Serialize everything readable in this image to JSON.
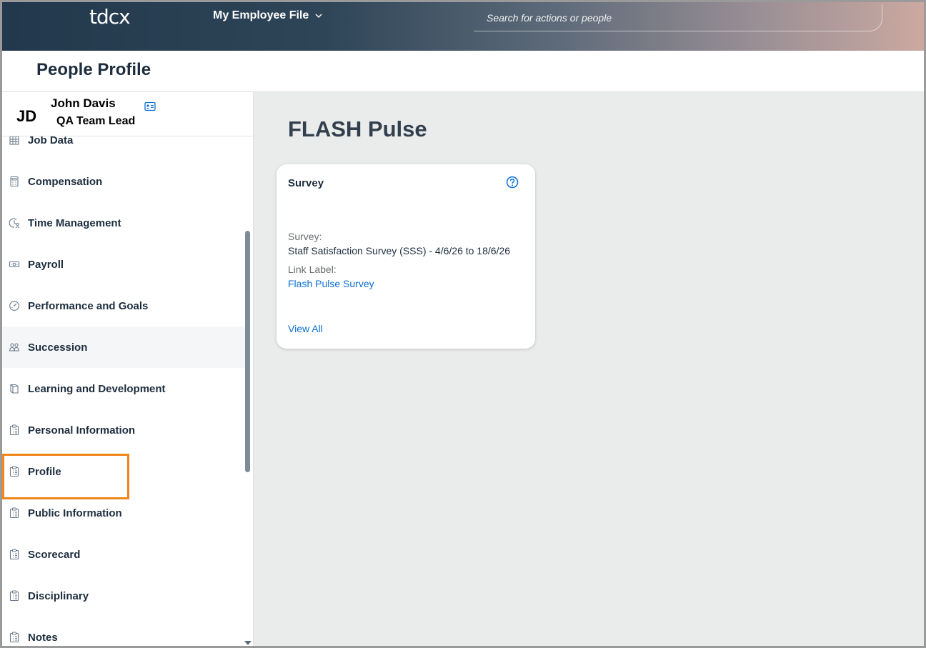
{
  "shell": {
    "logo": "tdcx",
    "app_menu_label": "My Employee File",
    "search_placeholder": "Search for actions or people"
  },
  "page": {
    "title": "People Profile"
  },
  "employee": {
    "initials": "JD",
    "name": "John Davis",
    "role": "QA Team Lead"
  },
  "sidebar": {
    "items": [
      {
        "label": "Job Data",
        "icon": "building-icon"
      },
      {
        "label": "Compensation",
        "icon": "calculator-icon"
      },
      {
        "label": "Time Management",
        "icon": "clock-person-icon"
      },
      {
        "label": "Payroll",
        "icon": "money-bill-icon"
      },
      {
        "label": "Performance and Goals",
        "icon": "gauge-icon"
      },
      {
        "label": "Succession",
        "icon": "people-group-icon"
      },
      {
        "label": "Learning and Development",
        "icon": "book-icon"
      },
      {
        "label": "Personal Information",
        "icon": "clipboard-list-icon"
      },
      {
        "label": "Profile",
        "icon": "clipboard-list-icon"
      },
      {
        "label": "Public Information",
        "icon": "clipboard-list-icon"
      },
      {
        "label": "Scorecard",
        "icon": "clipboard-list-icon"
      },
      {
        "label": "Disciplinary",
        "icon": "clipboard-list-icon"
      },
      {
        "label": "Notes",
        "icon": "clipboard-list-icon"
      }
    ]
  },
  "main": {
    "section_title": "FLASH Pulse",
    "card": {
      "title": "Survey",
      "survey_label": "Survey:",
      "survey_value": "Staff Satisfaction Survey (SSS) - 4/6/26 to 18/6/26",
      "link_label_label": "Link Label:",
      "link_label_value": "Flash Pulse Survey",
      "view_all": "View All"
    }
  },
  "colors": {
    "highlight_border": "#f0861a",
    "link": "#0a6ed1",
    "main_bg": "#eaeceb"
  }
}
